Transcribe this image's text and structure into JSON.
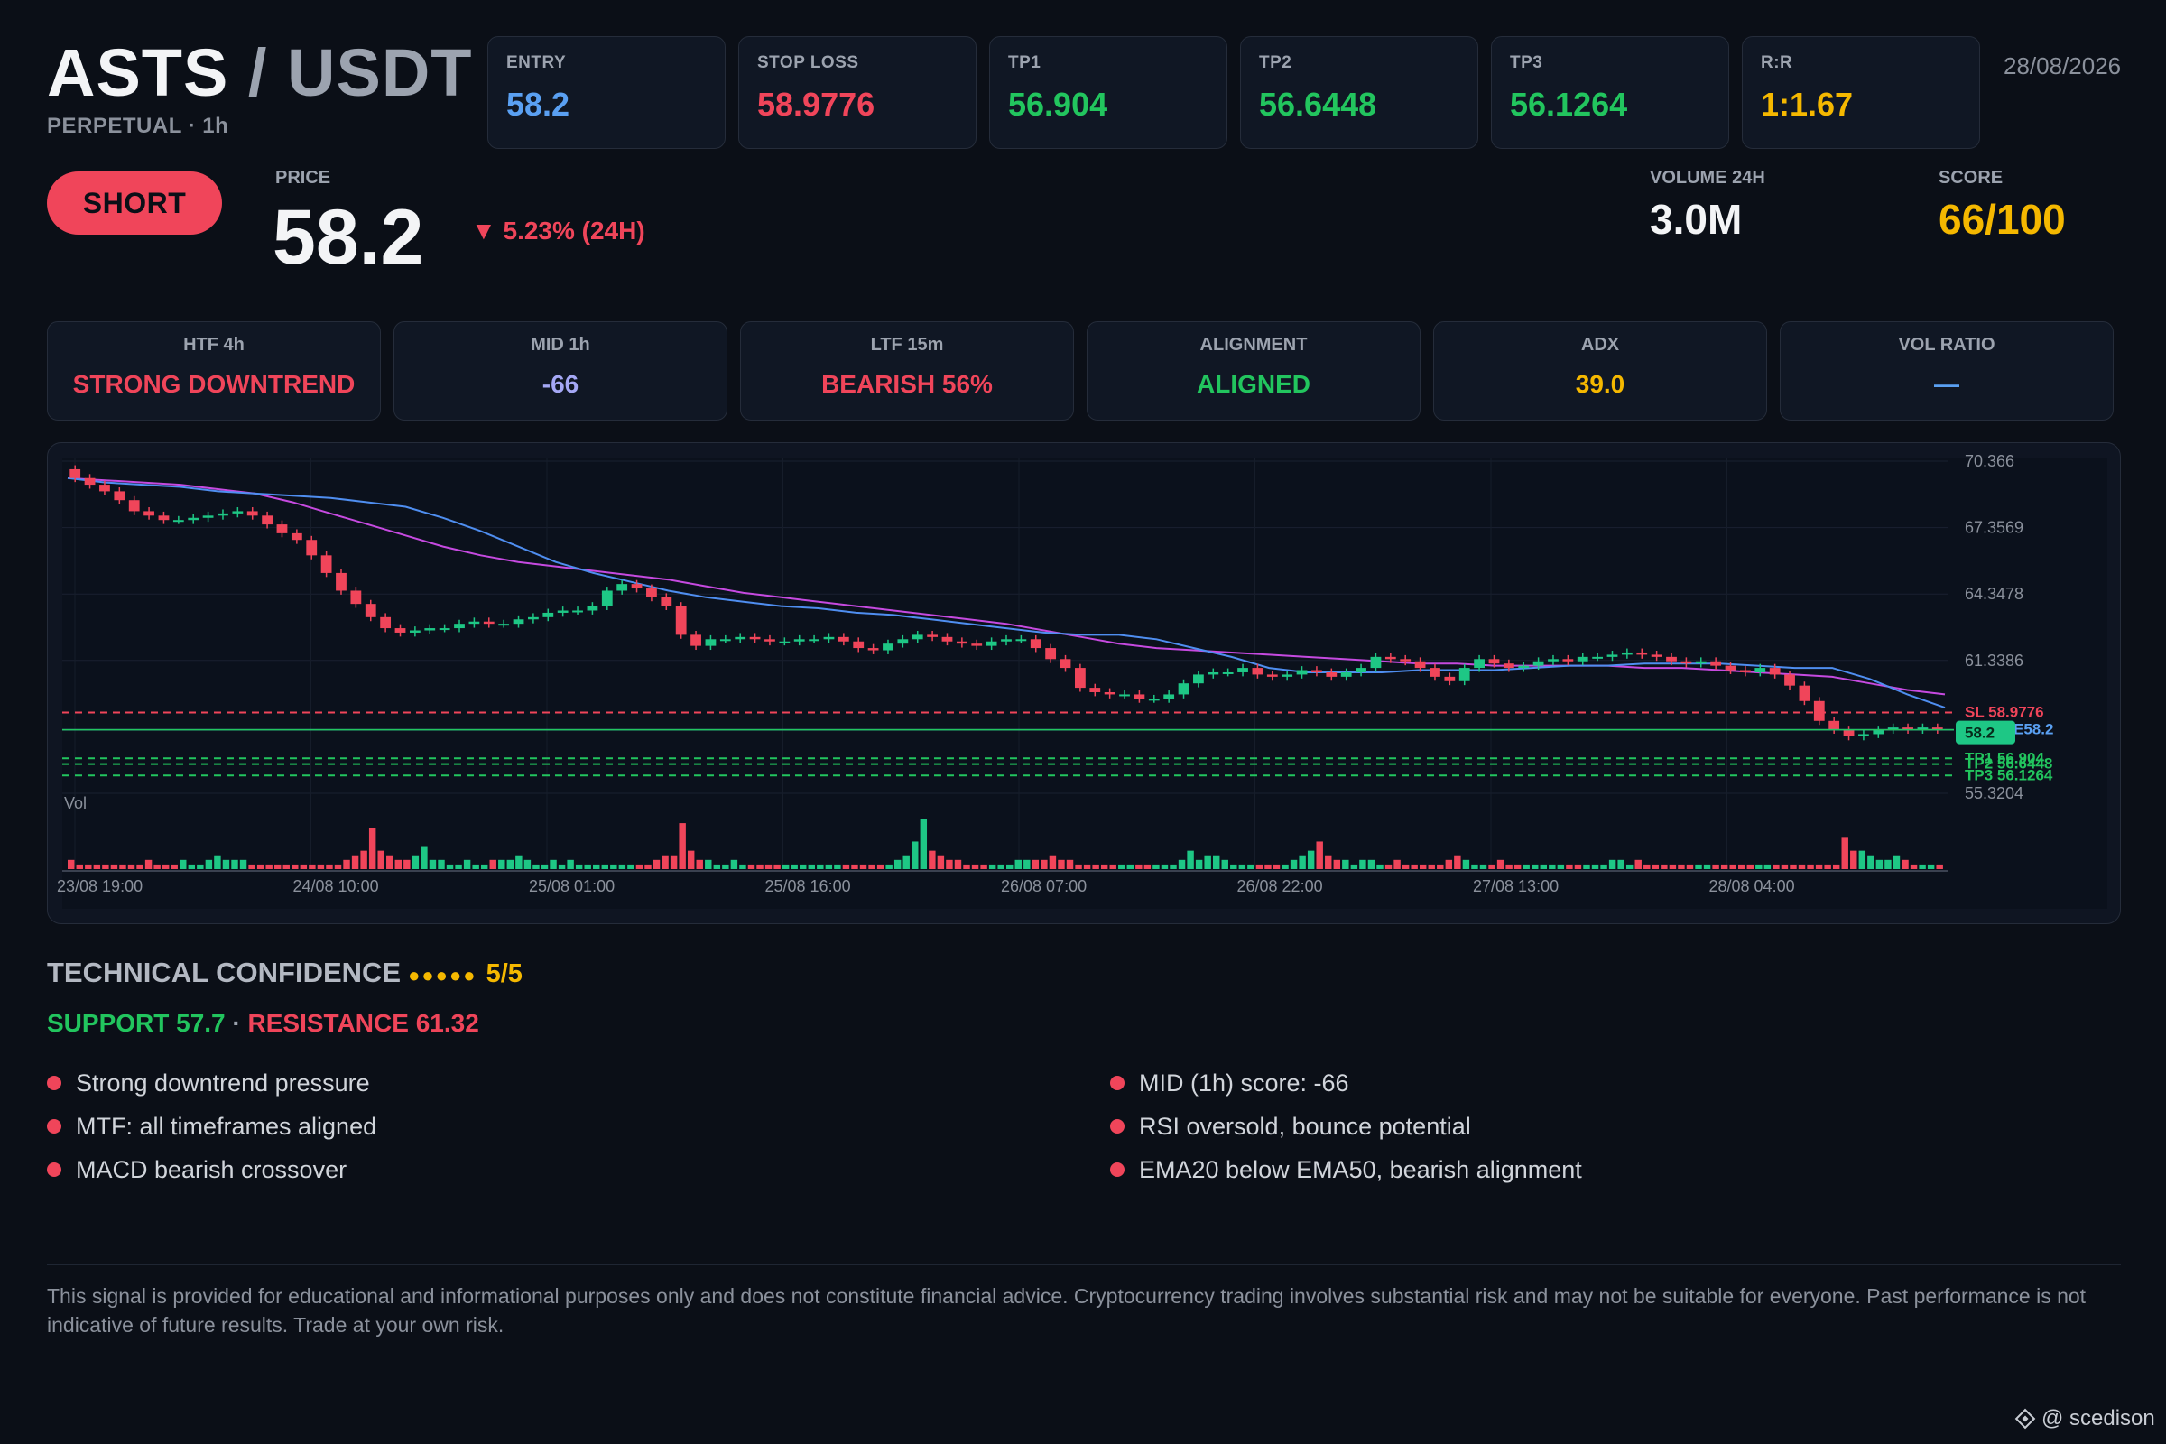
{
  "header": {
    "base": "ASTS",
    "separator": "/",
    "quote": "USDT",
    "subtitle": "PERPETUAL · 1h",
    "date": "28/08/2026"
  },
  "levels": [
    {
      "label": "ENTRY",
      "value": "58.2",
      "color": "#5aa0f2"
    },
    {
      "label": "STOP LOSS",
      "value": "58.9776",
      "color": "#f0455a"
    },
    {
      "label": "TP1",
      "value": "56.904",
      "color": "#22c55e"
    },
    {
      "label": "TP2",
      "value": "56.6448",
      "color": "#22c55e"
    },
    {
      "label": "TP3",
      "value": "56.1264",
      "color": "#22c55e"
    },
    {
      "label": "R:R",
      "value": "1:1.67",
      "color": "#f5b800"
    }
  ],
  "signal": {
    "direction": "SHORT",
    "price_label": "PRICE",
    "price": "58.2",
    "change": "▼ 5.23% (24H)",
    "volume_label": "VOLUME 24H",
    "volume": "3.0M",
    "score_label": "SCORE",
    "score": "66/100"
  },
  "timeframes": [
    {
      "label": "HTF 4h",
      "value": "STRONG DOWNTREND",
      "color": "#f0455a"
    },
    {
      "label": "MID 1h",
      "value": "-66",
      "color": "#a5a8f5"
    },
    {
      "label": "LTF 15m",
      "value": "BEARISH 56%",
      "color": "#f0455a"
    },
    {
      "label": "ALIGNMENT",
      "value": "ALIGNED",
      "color": "#22c55e"
    },
    {
      "label": "ADX",
      "value": "39.0",
      "color": "#f5b800"
    },
    {
      "label": "VOL RATIO",
      "value": "—",
      "color": "#5aa0f2"
    }
  ],
  "chart_data": {
    "type": "candlestick",
    "y_ticks": [
      "70.366",
      "67.3569",
      "64.3478",
      "61.3386",
      "55.3204"
    ],
    "ylim": [
      55.3204,
      70.366
    ],
    "x_ticks": [
      "23/08 19:00",
      "24/08 10:00",
      "25/08 01:00",
      "25/08 16:00",
      "26/08 07:00",
      "26/08 22:00",
      "27/08 13:00",
      "28/08 04:00"
    ],
    "volume_label": "Vol",
    "price_tag": "58.2",
    "lines": [
      {
        "label": "SL 58.9776",
        "value": 58.9776,
        "color": "#f0455a"
      },
      {
        "label": "TP1 56.904",
        "value": 56.904,
        "color": "#22c55e"
      },
      {
        "label": "TP2 56.6448",
        "value": 56.6448,
        "color": "#22c55e"
      },
      {
        "label": "TP3 56.1264",
        "value": 56.1264,
        "color": "#22c55e"
      },
      {
        "label": "E58.2",
        "value": 58.2,
        "color": "#5aa0f2"
      }
    ],
    "close": [
      69.6,
      69.3,
      69.0,
      68.6,
      68.1,
      67.9,
      67.7,
      67.7,
      67.8,
      67.9,
      68.0,
      68.1,
      67.9,
      67.5,
      67.1,
      66.8,
      66.1,
      65.3,
      64.5,
      63.9,
      63.3,
      62.8,
      62.6,
      62.7,
      62.8,
      62.8,
      63.0,
      63.1,
      63.0,
      63.0,
      63.2,
      63.3,
      63.5,
      63.6,
      63.6,
      63.8,
      64.5,
      64.8,
      64.6,
      64.2,
      63.8,
      62.5,
      62.0,
      62.3,
      62.3,
      62.4,
      62.3,
      62.2,
      62.2,
      62.3,
      62.3,
      62.4,
      62.2,
      61.9,
      61.8,
      62.1,
      62.3,
      62.5,
      62.4,
      62.2,
      62.1,
      62.0,
      62.2,
      62.3,
      62.3,
      61.9,
      61.4,
      61.0,
      60.1,
      59.9,
      59.8,
      59.8,
      59.6,
      59.6,
      59.8,
      60.3,
      60.7,
      60.8,
      60.8,
      61.0,
      60.7,
      60.6,
      60.7,
      60.9,
      60.8,
      60.6,
      60.8,
      61.0,
      61.5,
      61.4,
      61.3,
      61.0,
      60.6,
      60.4,
      61.0,
      61.4,
      61.2,
      61.0,
      61.1,
      61.3,
      61.4,
      61.3,
      61.5,
      61.5,
      61.6,
      61.7,
      61.6,
      61.5,
      61.3,
      61.2,
      61.3,
      61.1,
      60.9,
      60.8,
      61.0,
      60.7,
      60.2,
      59.5,
      58.6,
      58.2,
      57.9,
      58.0,
      58.2,
      58.3,
      58.2,
      58.3,
      58.2
    ],
    "ema20": [
      69.6,
      69.4,
      69.3,
      69.2,
      69.0,
      68.9,
      68.8,
      68.7,
      68.5,
      68.3,
      67.8,
      67.2,
      66.5,
      65.8,
      65.3,
      64.9,
      64.5,
      64.2,
      64.0,
      63.8,
      63.7,
      63.5,
      63.4,
      63.2,
      63.0,
      62.8,
      62.6,
      62.5,
      62.5,
      62.3,
      61.9,
      61.5,
      61.0,
      60.8,
      60.8,
      60.8,
      60.9,
      60.9,
      60.9,
      61.0,
      61.1,
      61.1,
      61.2,
      61.2,
      61.2,
      61.1,
      61.0,
      61.0,
      60.5,
      59.8,
      59.2
    ],
    "ema50": [
      69.6,
      69.5,
      69.4,
      69.3,
      69.1,
      68.9,
      68.5,
      68.0,
      67.5,
      67.0,
      66.5,
      66.1,
      65.8,
      65.6,
      65.4,
      65.2,
      65.0,
      64.7,
      64.4,
      64.2,
      64.0,
      63.8,
      63.6,
      63.4,
      63.2,
      63.0,
      62.7,
      62.4,
      62.1,
      61.9,
      61.8,
      61.7,
      61.6,
      61.5,
      61.4,
      61.3,
      61.2,
      61.2,
      61.1,
      61.1,
      61.1,
      61.1,
      61.0,
      61.0,
      60.9,
      60.8,
      60.7,
      60.6,
      60.3,
      60.0,
      59.8
    ],
    "volume": [
      2,
      1,
      1,
      1,
      1,
      1,
      1,
      1,
      1,
      2,
      1,
      1,
      1,
      2,
      1,
      1,
      2,
      3,
      2,
      2,
      2,
      1,
      1,
      1,
      1,
      1,
      1,
      1,
      1,
      1,
      1,
      1,
      2,
      3,
      4,
      9,
      4,
      3,
      2,
      2,
      3,
      5,
      2,
      2,
      1,
      1,
      2,
      1,
      1,
      2,
      2,
      2,
      3,
      2,
      1,
      1,
      2,
      1,
      2,
      1,
      1,
      1,
      1,
      1,
      1,
      1,
      1,
      1,
      2,
      3,
      3,
      10,
      4,
      2,
      2,
      1,
      1,
      2,
      1,
      1,
      1,
      1,
      1,
      1,
      1,
      1,
      1,
      1,
      1,
      1,
      1,
      1,
      1,
      1,
      1,
      1,
      2,
      3,
      6,
      11,
      4,
      3,
      2,
      2,
      1,
      1,
      1,
      1,
      1,
      1,
      2,
      2,
      2,
      2,
      3,
      2,
      2,
      1,
      1,
      1,
      1,
      1,
      1,
      1,
      1,
      1,
      1,
      1,
      1,
      2,
      4,
      2,
      3,
      3,
      2,
      1,
      1,
      1,
      1,
      1,
      1,
      1,
      2,
      3,
      4,
      6,
      3,
      2,
      2,
      1,
      2,
      2,
      1,
      1,
      2,
      1,
      1,
      1,
      1,
      1,
      2,
      3,
      2,
      1,
      1,
      1,
      2,
      1,
      1,
      1,
      1,
      1,
      1,
      1,
      1,
      1,
      1,
      1,
      1,
      2,
      2,
      1,
      2,
      1,
      1,
      1,
      1,
      1,
      1,
      1,
      1,
      1,
      1,
      1,
      1,
      1,
      1,
      1,
      1,
      1,
      1,
      1,
      1,
      1,
      1,
      1,
      7,
      4,
      4,
      3,
      2,
      2,
      3,
      2,
      1,
      1,
      1,
      1
    ]
  },
  "confidence": {
    "title": "TECHNICAL CONFIDENCE",
    "dots": "●●●●●",
    "score": "5/5",
    "support": "SUPPORT 57.7",
    "sep": " · ",
    "resistance": "RESISTANCE 61.32"
  },
  "reasons_left": [
    "Strong downtrend pressure",
    "MTF: all timeframes aligned",
    "MACD bearish crossover"
  ],
  "reasons_right": [
    "MID (1h) score: -66",
    "RSI oversold, bounce potential",
    "EMA20 below EMA50, bearish alignment"
  ],
  "disclaimer": "This signal is provided for educational and informational purposes only and does not constitute financial advice. Cryptocurrency trading involves substantial risk and may not be suitable for everyone. Past performance is not indicative of future results. Trade at your own risk.",
  "watermark": "@ scedison"
}
